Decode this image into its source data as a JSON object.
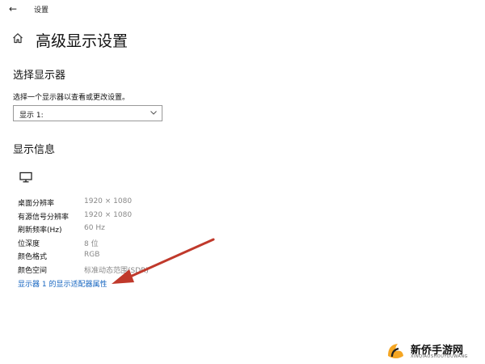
{
  "titlebar": {
    "back_glyph": "←",
    "app_title": "设置"
  },
  "page": {
    "title": "高级显示设置"
  },
  "select_display": {
    "heading": "选择显示器",
    "description": "选择一个显示器以查看或更改设置。",
    "selected": "显示 1:"
  },
  "display_info": {
    "heading": "显示信息",
    "rows": [
      {
        "label": "桌面分辨率",
        "value": "1920 × 1080"
      },
      {
        "label": "有源信号分辨率",
        "value": "1920 × 1080"
      },
      {
        "label": "刷新频率(Hz)",
        "value": "60 Hz"
      },
      {
        "label": "位深度",
        "value": "8 位"
      },
      {
        "label": "颜色格式",
        "value": "RGB"
      },
      {
        "label": "颜色空间",
        "value": "标准动态范围(SDR)"
      }
    ],
    "adapter_link": "显示器 1 的显示适配器属性"
  },
  "annotation": {
    "arrow_color": "#c0392b"
  },
  "watermark": {
    "name": "新侨手游网",
    "sub": "XINQIAOSHOUYOUWANG"
  },
  "icons": {
    "home": "home-icon",
    "monitor": "monitor-icon",
    "chevron": "chevron-down-icon",
    "back": "back-arrow-icon"
  }
}
